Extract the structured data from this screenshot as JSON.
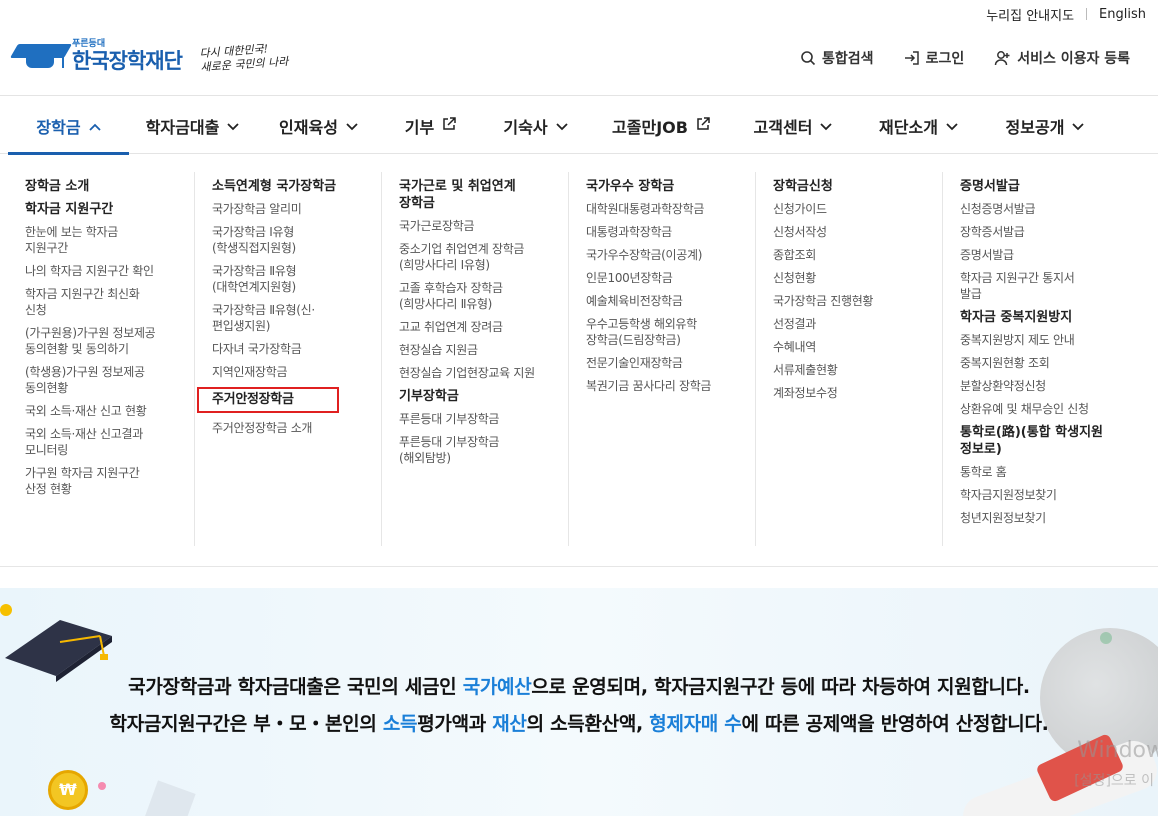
{
  "util": {
    "sitemap": "누리집 안내지도",
    "english": "English"
  },
  "logo": {
    "small": "푸른등대",
    "name": "한국장학재단",
    "slogan1": "다시 대한민국!",
    "slogan2": "새로운 국민의 나라"
  },
  "header_links": {
    "search": "통합검색",
    "login": "로그인",
    "register": "서비스 이용자 등록"
  },
  "gnb": [
    {
      "label": "장학금",
      "icon": "chevron-up"
    },
    {
      "label": "학자금대출",
      "icon": "chevron-down"
    },
    {
      "label": "인재육성",
      "icon": "chevron-down"
    },
    {
      "label": "기부",
      "icon": "external-link"
    },
    {
      "label": "기숙사",
      "icon": "chevron-down"
    },
    {
      "label": "고졸만JOB",
      "icon": "external-link"
    },
    {
      "label": "고객센터",
      "icon": "chevron-down"
    },
    {
      "label": "재단소개",
      "icon": "chevron-down"
    },
    {
      "label": "정보공개",
      "icon": "chevron-down"
    }
  ],
  "mega": {
    "col1": {
      "h1": "장학금 소개",
      "h2": "학자금 지원구간",
      "items": [
        "한눈에 보는 학자금\n지원구간",
        "나의 학자금 지원구간 확인",
        "학자금 지원구간 최신화\n신청",
        "(가구원용)가구원 정보제공\n동의현황 및 동의하기",
        "(학생용)가구원 정보제공\n동의현황",
        "국외 소득·재산 신고 현황",
        "국외 소득·재산 신고결과\n모니터링",
        "가구원 학자금 지원구간\n산정 현황"
      ]
    },
    "col2": {
      "h1": "소득연계형 국가장학금",
      "items": [
        "국가장학금 알리미",
        "국가장학금 Ⅰ유형\n(학생직접지원형)",
        "국가장학금 Ⅱ유형\n(대학연계지원형)",
        "국가장학금 Ⅱ유형(신·\n편입생지원)",
        "다자녀 국가장학금",
        "지역인재장학금"
      ],
      "highlight": "주거안정장학금",
      "after": "주거안정장학금 소개"
    },
    "col3": {
      "h1": "국가근로 및 취업연계\n장학금",
      "items": [
        "국가근로장학금",
        "중소기업 취업연계 장학금\n(희망사다리 Ⅰ유형)",
        "고졸 후학습자 장학금\n(희망사다리 Ⅱ유형)",
        "고교 취업연계 장려금",
        "현장실습 지원금",
        "현장실습 기업현장교육 지원"
      ],
      "h2": "기부장학금",
      "items2": [
        "푸른등대 기부장학금",
        "푸른등대 기부장학금\n(해외탐방)"
      ]
    },
    "col4": {
      "h1": "국가우수 장학금",
      "items": [
        "대학원대통령과학장학금",
        "대통령과학장학금",
        "국가우수장학금(이공계)",
        "인문100년장학금",
        "예술체육비전장학금",
        "우수고등학생 해외유학\n장학금(드림장학금)",
        "전문기술인재장학금",
        "복권기금 꿈사다리 장학금"
      ]
    },
    "col5": {
      "h1": "장학금신청",
      "items": [
        "신청가이드",
        "신청서작성",
        "종합조회",
        "신청현황",
        "국가장학금 진행현황",
        "선정결과",
        "수혜내역",
        "서류제출현황",
        "계좌정보수정"
      ]
    },
    "col6": {
      "h1": "증명서발급",
      "items": [
        "신청증명서발급",
        "장학증서발급",
        "증명서발급",
        "학자금 지원구간 통지서\n발급"
      ],
      "h2": "학자금 중복지원방지",
      "items2": [
        "중복지원방지 제도 안내",
        "중복지원현황 조회",
        "분할상환약정신청",
        "상환유예 및 채무승인 신청"
      ],
      "h3": "통학로(路)(통합 학생지원\n정보로)",
      "items3": [
        "통학로 홈",
        "학자금지원정보찾기",
        "청년지원정보찾기"
      ]
    }
  },
  "banner": {
    "l1_a": "국가장학금과 학자금대출은 국민의 세금인 ",
    "l1_em": "국가예산",
    "l1_b": "으로 운영되며, 학자금지원구간 등에 따라 차등하여 지원합니다.",
    "l2_a": "학자금지원구간은 부・모・본인의 ",
    "l2_em1": "소득",
    "l2_b": "평가액과 ",
    "l2_em2": "재산",
    "l2_c": "의 소득환산액, ",
    "l2_em3": "형제자매 수",
    "l2_d": "에 따른 공제액을 반영하여 산정합니다.",
    "coin": "₩",
    "watermark1": "Window",
    "watermark2": "[설정]으로 이"
  },
  "colors": {
    "brand": "#1a5fae",
    "emphasis": "#1a7fd8",
    "highlight_border": "#e02020"
  }
}
